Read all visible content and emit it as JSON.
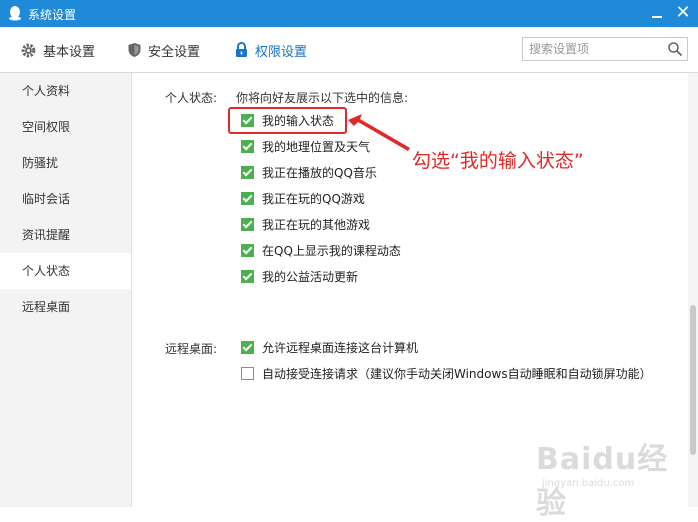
{
  "window": {
    "title": "系统设置"
  },
  "topnav": {
    "tabs": [
      {
        "label": "基本设置",
        "icon": "gear-icon"
      },
      {
        "label": "安全设置",
        "icon": "shield-icon"
      },
      {
        "label": "权限设置",
        "icon": "lock-icon",
        "active": true
      }
    ],
    "search_placeholder": "搜索设置项"
  },
  "sidebar": {
    "items": [
      {
        "label": "个人资料"
      },
      {
        "label": "空间权限"
      },
      {
        "label": "防骚扰"
      },
      {
        "label": "临时会话"
      },
      {
        "label": "资讯提醒"
      },
      {
        "label": "个人状态",
        "active": true
      },
      {
        "label": "远程桌面"
      }
    ]
  },
  "personal_status": {
    "label": "个人状态:",
    "description": "你将向好友展示以下选中的信息:",
    "options": [
      {
        "label": "我的输入状态",
        "checked": true
      },
      {
        "label": "我的地理位置及天气",
        "checked": true
      },
      {
        "label": "我正在播放的QQ音乐",
        "checked": true
      },
      {
        "label": "我正在玩的QQ游戏",
        "checked": true
      },
      {
        "label": "我正在玩的其他游戏",
        "checked": true
      },
      {
        "label": "在QQ上显示我的课程动态",
        "checked": true
      },
      {
        "label": "我的公益活动更新",
        "checked": true
      }
    ]
  },
  "remote_desktop": {
    "label": "远程桌面:",
    "options": [
      {
        "label": "允许远程桌面连接这台计算机",
        "checked": true
      },
      {
        "label": "自动接受连接请求（建议你手动关闭Windows自动睡眠和自动锁屏功能）",
        "checked": false
      }
    ]
  },
  "annotation": {
    "text": "勾选“我的输入状态”",
    "color": "#e02a2a"
  },
  "watermark": {
    "text": "Baidu经验",
    "sub": "jingyan.baidu.com"
  },
  "colors": {
    "titlebar": "#1f8ad8",
    "accent": "#1a73c9",
    "check": "#4caf50"
  }
}
